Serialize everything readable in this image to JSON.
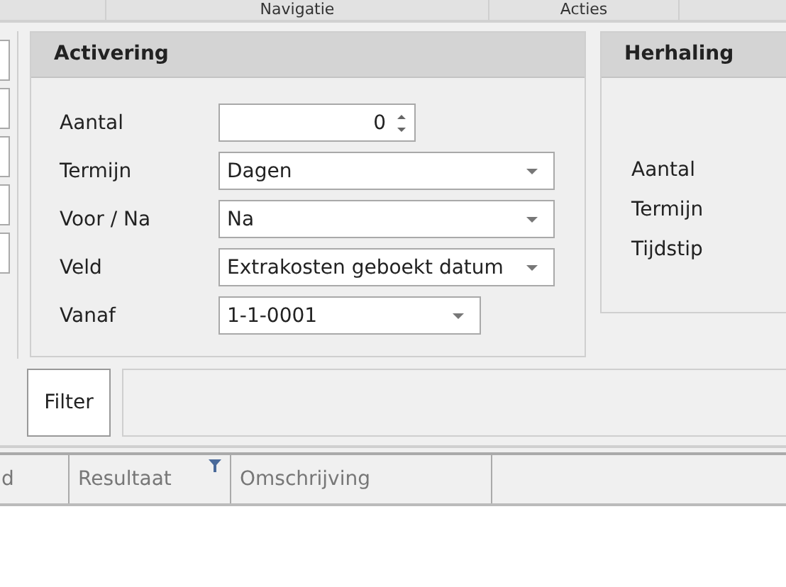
{
  "top_tabs": [
    {
      "label": "Navigatie"
    },
    {
      "label": "Acties"
    }
  ],
  "activering": {
    "title": "Activering",
    "fields": [
      {
        "kind": "spin",
        "label": "Aantal",
        "value": "0"
      },
      {
        "kind": "combo",
        "label": "Termijn",
        "value": "Dagen"
      },
      {
        "kind": "combo",
        "label": "Voor / Na",
        "value": "Na"
      },
      {
        "kind": "combo",
        "label": "Veld",
        "value": "Extrakosten geboekt datum"
      },
      {
        "kind": "date",
        "label": "Vanaf",
        "value": "1-1-0001"
      }
    ]
  },
  "herhaling": {
    "title": "Herhaling",
    "labels": [
      "Aantal",
      "Termijn",
      "Tijdstip"
    ]
  },
  "filter_button": "Filter",
  "grid": {
    "columns": [
      {
        "label": "d",
        "filtered": false
      },
      {
        "label": "Resultaat",
        "filtered": true
      },
      {
        "label": "Omschrijving",
        "filtered": false
      }
    ]
  }
}
